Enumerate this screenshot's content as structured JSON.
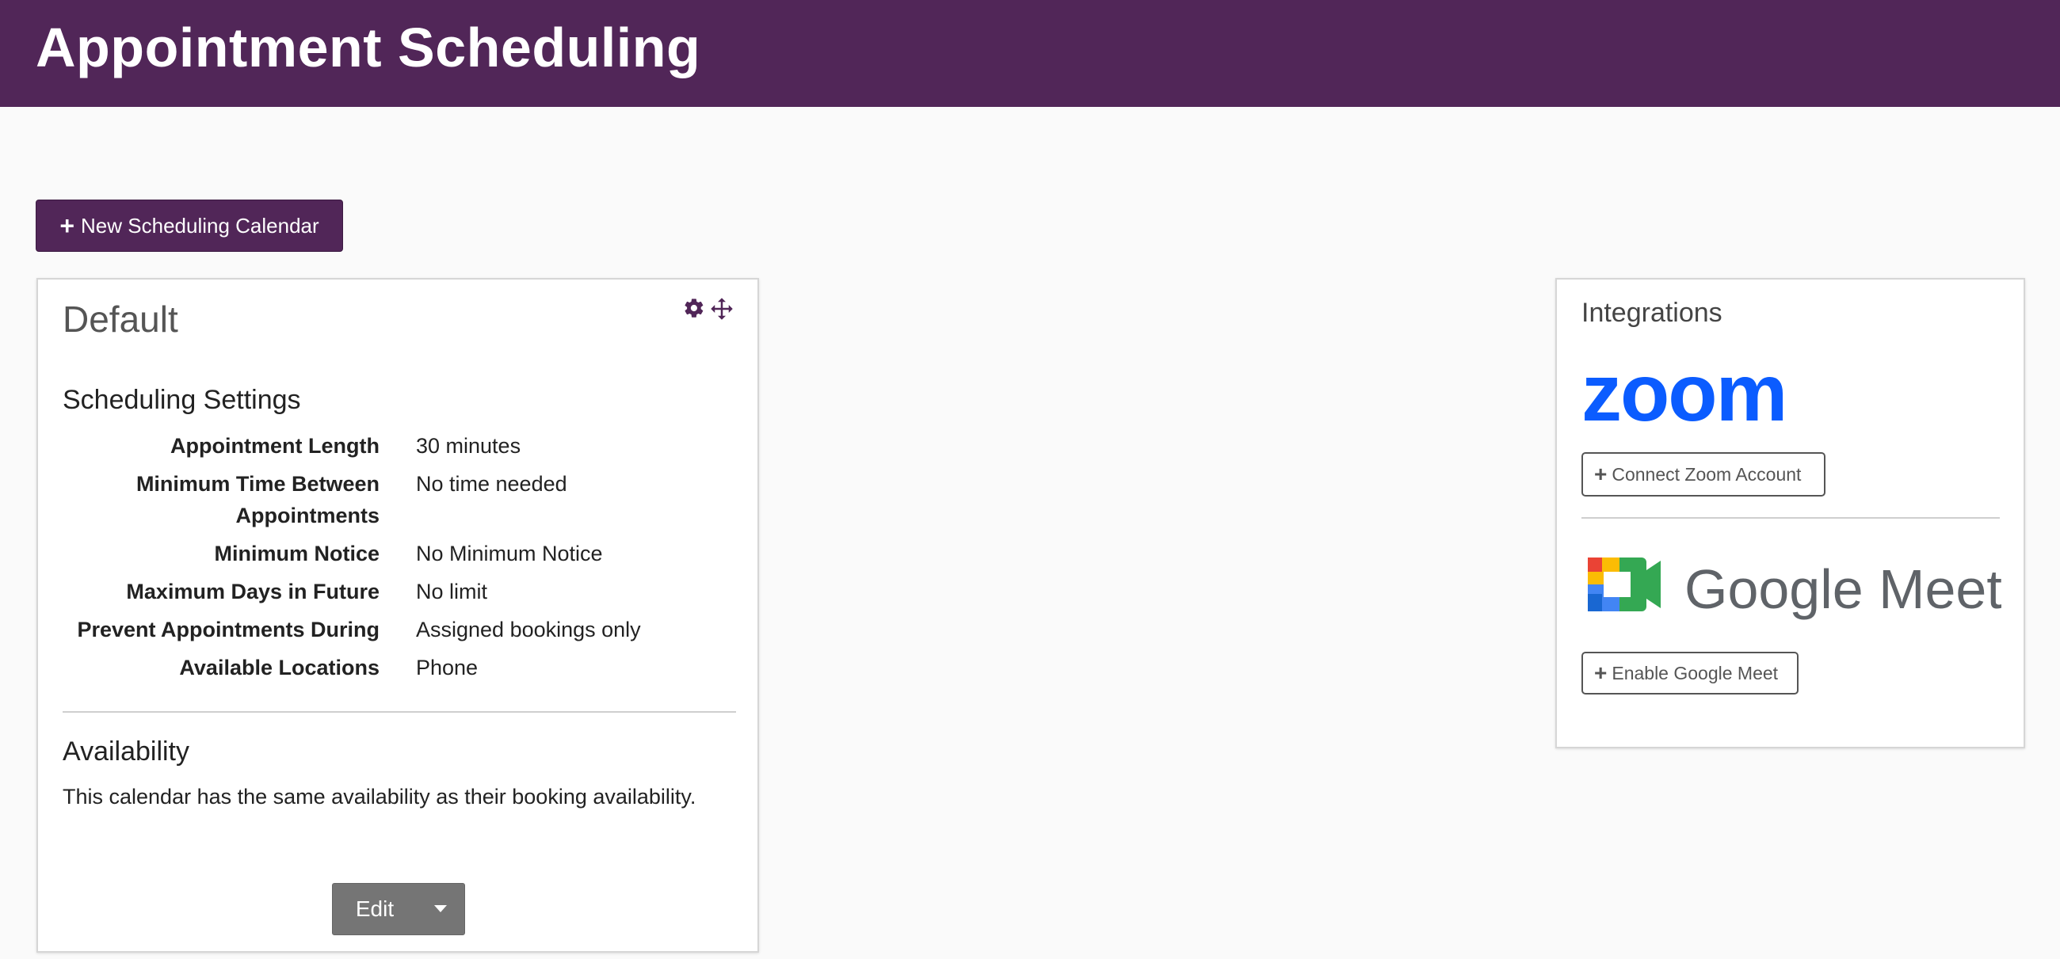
{
  "header": {
    "title": "Appointment Scheduling"
  },
  "toolbar": {
    "new_calendar_label": "New Scheduling Calendar"
  },
  "calendar": {
    "title": "Default",
    "scheduling_heading": "Scheduling Settings",
    "settings": [
      {
        "label": "Appointment Length",
        "value": "30 minutes"
      },
      {
        "label": "Minimum Time Between Appointments",
        "value": "No time needed"
      },
      {
        "label": "Minimum Notice",
        "value": "No Minimum Notice"
      },
      {
        "label": "Maximum Days in Future",
        "value": "No limit"
      },
      {
        "label": "Prevent Appointments During",
        "value": "Assigned bookings only"
      },
      {
        "label": "Available Locations",
        "value": "Phone"
      }
    ],
    "availability_heading": "Availability",
    "availability_text": "This calendar has the same availability as their booking availability.",
    "edit_label": "Edit"
  },
  "integrations": {
    "title": "Integrations",
    "zoom_logo_text": "zoom",
    "zoom_button": "Connect Zoom Account",
    "meet_logo_text": "Google Meet",
    "meet_button": "Enable Google Meet"
  },
  "colors": {
    "brand": "#512658",
    "zoom_blue": "#0b5cff",
    "meet_text": "#5f6368",
    "edit_gray": "#757575"
  },
  "icons": {
    "new_calendar": "plus-icon",
    "settings": "gear-icon",
    "move": "move-icon",
    "dropdown": "caret-down-icon",
    "zoom": "zoom-logo",
    "meet": "google-meet-logo"
  }
}
